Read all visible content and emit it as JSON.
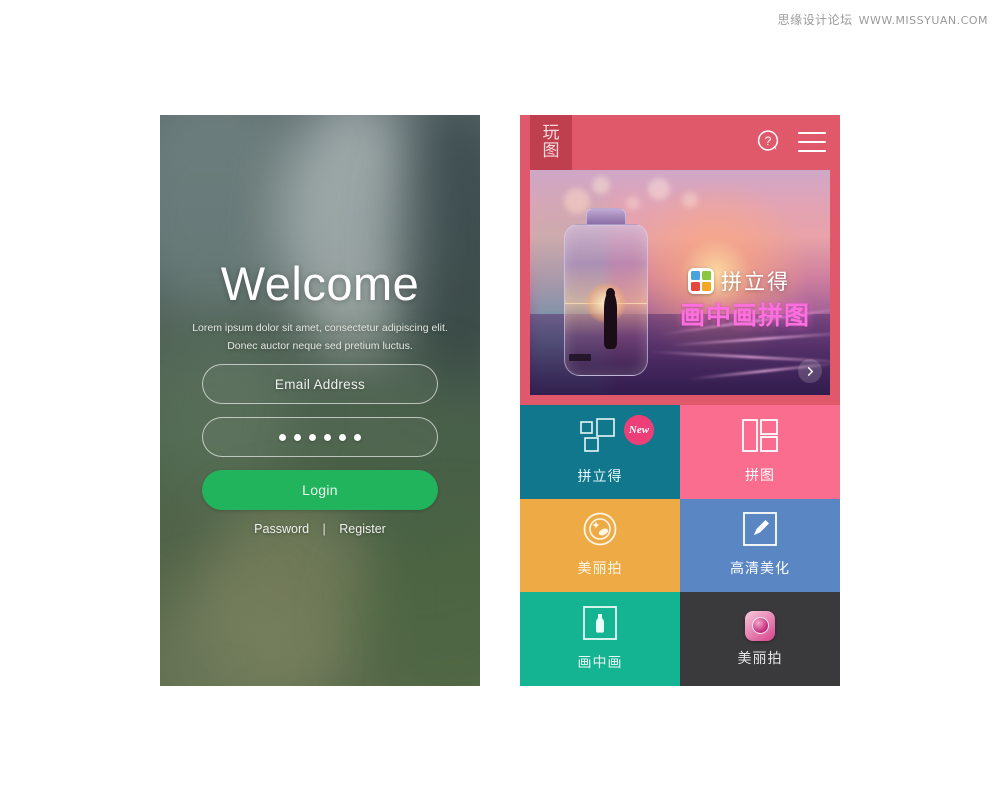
{
  "watermark": {
    "cn": "思缘设计论坛",
    "url": "WWW.MISSYUAN.COM"
  },
  "login_screen": {
    "title": "Welcome",
    "subtitle_line1": "Lorem ipsum dolor sit amet, consectetur adipiscing elit.",
    "subtitle_line2": "Donec auctor neque sed pretium luctus.",
    "email_field": {
      "name": "email-field",
      "placeholder": "Email Address",
      "value": ""
    },
    "password_field": {
      "name": "password-field",
      "masked_value": "••••••",
      "dot_count": 6
    },
    "login_button": {
      "label": "Login",
      "color": "#21b45c"
    },
    "footer_links": {
      "password": "Password",
      "separator": "|",
      "register": "Register"
    }
  },
  "app_screen": {
    "header": {
      "logo_char1": "玩",
      "logo_char2": "图",
      "logo_bg": "#c03f4e",
      "bar_bg": "#e0596a",
      "help_icon": "help-question-bubble-icon",
      "menu_icon": "hamburger-menu-icon"
    },
    "banner": {
      "brand_name": "拼立得",
      "title": "画中画拼图",
      "brand_icon": "pinlide-app-icon",
      "next_arrow": "chevron-right-icon",
      "title_color": "#ff6fe0"
    },
    "tiles": [
      {
        "label": "拼立得",
        "bg": "#10778c",
        "text_color": "#e8f6f8",
        "icon": "collage-squares-icon",
        "badge": "New"
      },
      {
        "label": "拼图",
        "bg": "#fb6d8e",
        "text_color": "#ffffff",
        "icon": "puzzle-layout-icon",
        "badge": ""
      },
      {
        "label": "美丽拍",
        "bg": "#eeaa45",
        "text_color": "#fff6e6",
        "icon": "camera-lens-sparkle-icon",
        "badge": ""
      },
      {
        "label": "高清美化",
        "bg": "#5b86c4",
        "text_color": "#ffffff",
        "icon": "pencil-edit-icon",
        "badge": ""
      },
      {
        "label": "画中画",
        "bg": "#14b391",
        "text_color": "#eafaf5",
        "icon": "bottle-frame-icon",
        "badge": ""
      },
      {
        "label": "美丽拍",
        "bg": "#3a3a3c",
        "text_color": "#e6e6e6",
        "icon": "meilipai-app-icon",
        "badge": ""
      }
    ]
  }
}
